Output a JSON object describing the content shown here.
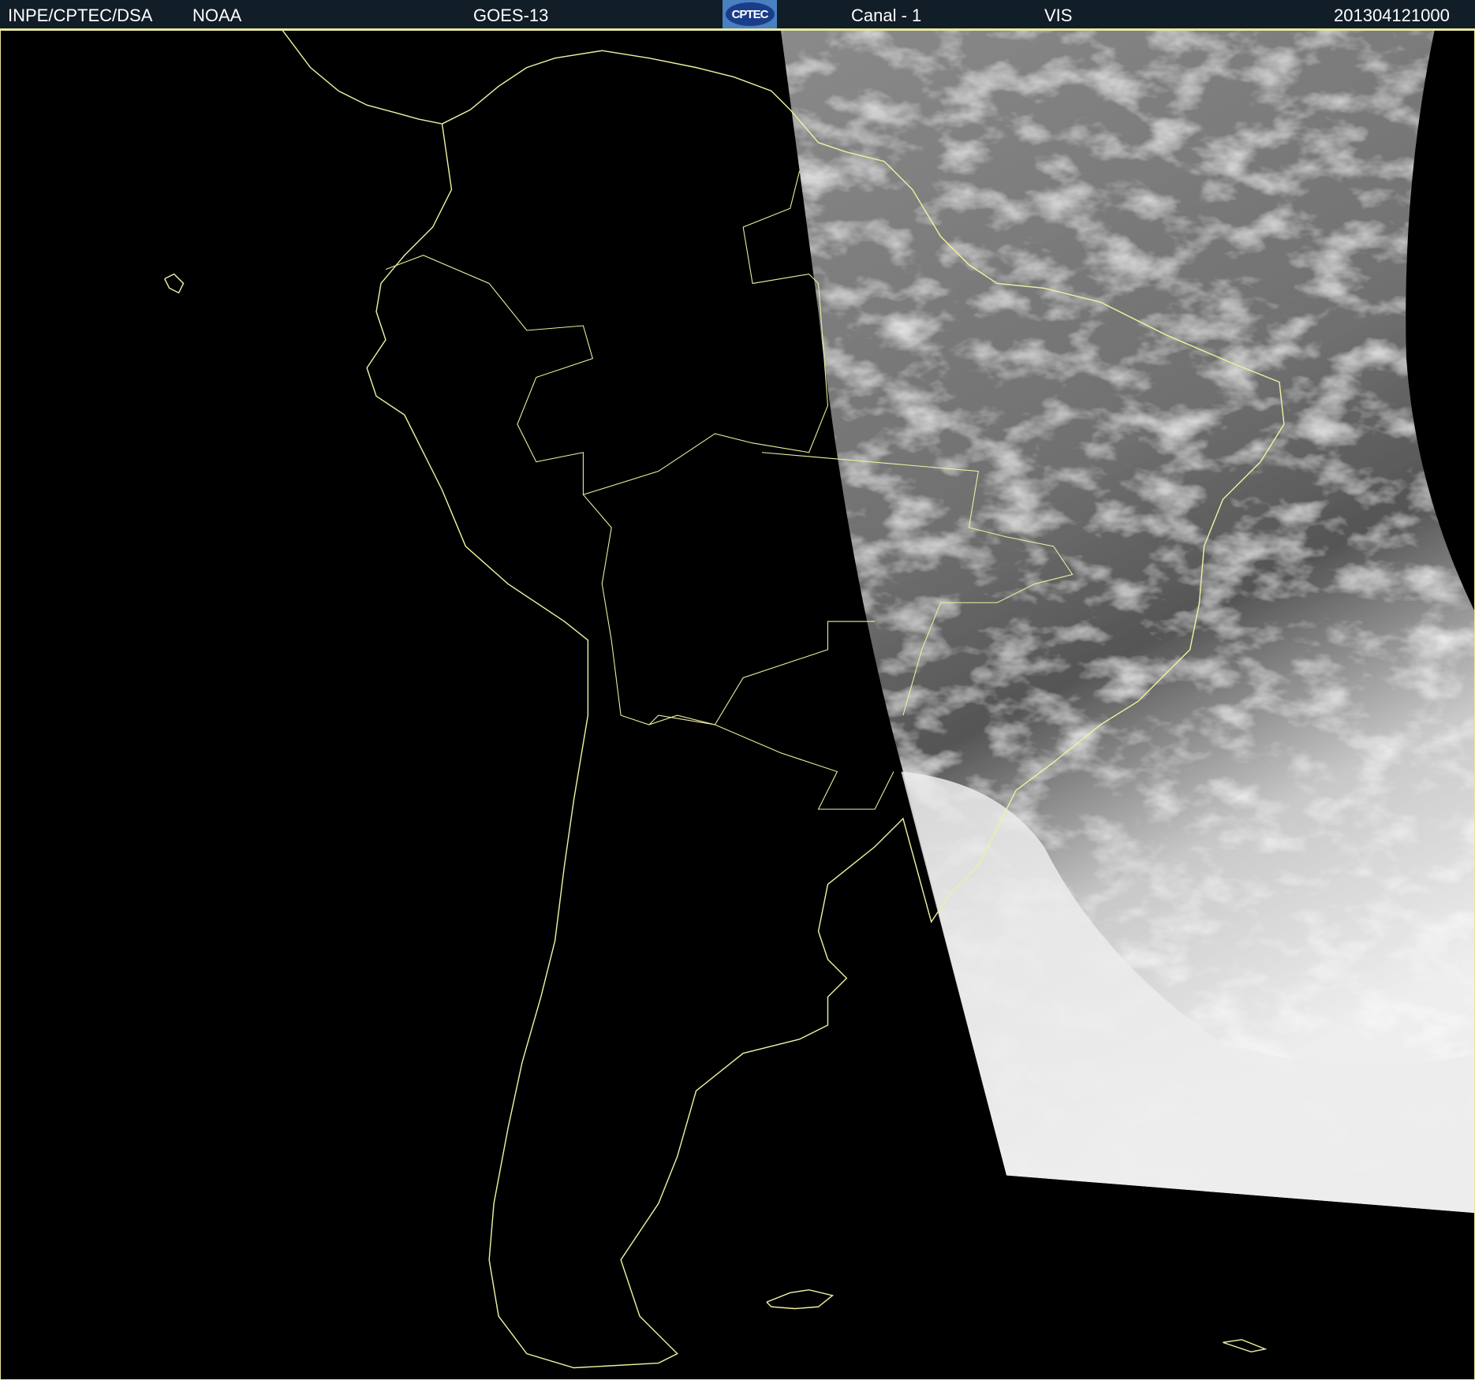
{
  "header": {
    "org": "INPE/CPTEC/DSA",
    "agency": "NOAA",
    "satellite": "GOES-13",
    "logo_text": "CPTEC",
    "channel": "Canal - 1",
    "band": "VIS",
    "timestamp": "201304121000"
  },
  "colors": {
    "header_bg": "#111d27",
    "coastline": "#f0f0a0",
    "background": "#000000"
  }
}
